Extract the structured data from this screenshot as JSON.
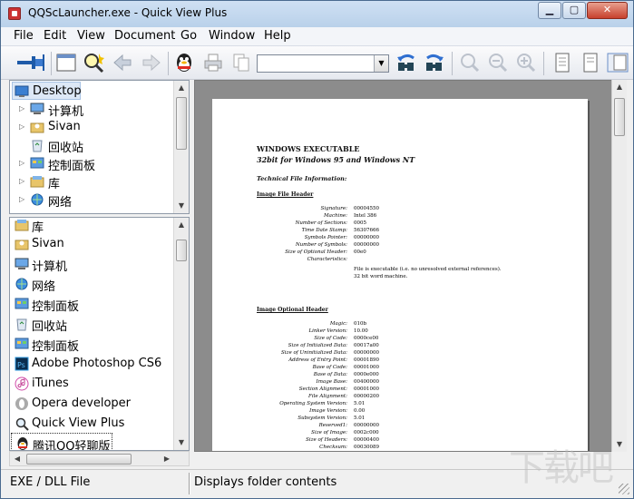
{
  "window": {
    "title": "QQScLauncher.exe - Quick View Plus"
  },
  "window_controls": {
    "minimize": "▁",
    "maximize": "▢",
    "close": "✕"
  },
  "menu": [
    "File",
    "Edit",
    "View",
    "Document",
    "Go",
    "Window",
    "Help"
  ],
  "toolbar": {
    "address_value": "",
    "icons": [
      "pin-icon",
      "window-icon",
      "find-icon",
      "back-icon",
      "forward-icon",
      "qq-icon",
      "print-icon",
      "copy-icon",
      "search-back-icon",
      "search-forward-icon",
      "zoom-icon",
      "zoom-out-icon",
      "zoom-in-icon",
      "page-view-icon",
      "document-icon",
      "split-view-icon"
    ]
  },
  "tree": {
    "items": [
      {
        "label": "Desktop",
        "expander": "",
        "selected": true
      },
      {
        "label": "计算机",
        "expander": "▷"
      },
      {
        "label": "Sivan",
        "expander": "▷"
      },
      {
        "label": "回收站",
        "expander": ""
      },
      {
        "label": "控制面板",
        "expander": "▷"
      },
      {
        "label": "库",
        "expander": "▷"
      },
      {
        "label": "网络",
        "expander": "▷"
      }
    ]
  },
  "file_list": {
    "items": [
      {
        "label": "库",
        "icon": "library-icon"
      },
      {
        "label": "Sivan",
        "icon": "user-folder-icon"
      },
      {
        "label": "计算机",
        "icon": "computer-icon"
      },
      {
        "label": "网络",
        "icon": "network-icon"
      },
      {
        "label": "控制面板",
        "icon": "control-panel-icon"
      },
      {
        "label": "回收站",
        "icon": "recycle-bin-icon"
      },
      {
        "label": "控制面板",
        "icon": "control-panel-icon"
      },
      {
        "label": "Adobe Photoshop CS6",
        "icon": "photoshop-icon"
      },
      {
        "label": "iTunes",
        "icon": "itunes-icon"
      },
      {
        "label": "Opera developer",
        "icon": "opera-icon"
      },
      {
        "label": "Quick View Plus",
        "icon": "magnifier-icon"
      },
      {
        "label": "腾讯QQ轻聊版",
        "icon": "qq-icon",
        "selected": true
      }
    ]
  },
  "document": {
    "title": "WINDOWS EXECUTABLE",
    "subtitle": "32bit for Windows 95 and Windows NT",
    "section_tfi": "Technical File Information:",
    "image_file_header": {
      "heading": "Image File Header",
      "rows": [
        [
          "Signature:",
          "00004550"
        ],
        [
          "Machine:",
          "Intel 386"
        ],
        [
          "Number of Sections:",
          "0005"
        ],
        [
          "Time Date Stamp:",
          "56307666"
        ],
        [
          "Symbols Pointer:",
          "00000000"
        ],
        [
          "Number of Symbols:",
          "00000000"
        ],
        [
          "Size of Optional Header:",
          "00e0"
        ],
        [
          "Characteristics:",
          ""
        ]
      ],
      "notes": [
        "File is executable  (i.e. no unresolved external references).",
        "32 bit word machine."
      ]
    },
    "image_optional_header": {
      "heading": "Image Optional Header",
      "rows": [
        [
          "Magic:",
          "010b"
        ],
        [
          "Linker Version:",
          "10.00"
        ],
        [
          "Size of Code:",
          "0000ce00"
        ],
        [
          "Size of Initialized Data:",
          "00017a00"
        ],
        [
          "Size of Uninitialized Data:",
          "00000000"
        ],
        [
          "Address of Entry Point:",
          "00001890"
        ],
        [
          "Base of Code:",
          "00001000"
        ],
        [
          "Base of Data:",
          "0000e000"
        ],
        [
          "Image Base:",
          "00400000"
        ],
        [
          "Section Alignment:",
          "00001000"
        ],
        [
          "File Alignment:",
          "00000200"
        ],
        [
          "Operating System Version:",
          "5.01"
        ],
        [
          "Image Version:",
          "0.00"
        ],
        [
          "Subsystem Version:",
          "5.01"
        ],
        [
          "Reserved1:",
          "00000000"
        ],
        [
          "Size of Image:",
          "0002c000"
        ],
        [
          "Size of Headers:",
          "00000400"
        ],
        [
          "Checksum:",
          "00030089"
        ]
      ]
    }
  },
  "status": {
    "left": "EXE / DLL File",
    "right": "Displays folder contents"
  },
  "watermark": {
    "text": "下载吧"
  }
}
